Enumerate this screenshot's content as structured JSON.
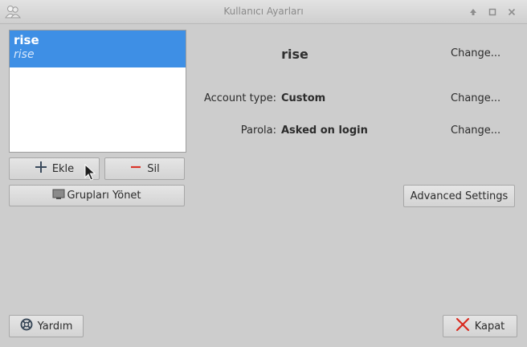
{
  "window": {
    "title": "Kullanıcı Ayarları"
  },
  "users": [
    {
      "name": "rise",
      "subtitle": "rise"
    }
  ],
  "toolbar": {
    "add_label": "Ekle",
    "delete_label": "Sil",
    "groups_label": "Grupları Yönet"
  },
  "details": {
    "name": "rise",
    "name_change": "Change...",
    "account_type_label": "Account type:",
    "account_type_value": "Custom",
    "account_type_change": "Change...",
    "password_label": "Parola:",
    "password_value": "Asked on login",
    "password_change": "Change...",
    "advanced_label": "Advanced Settings"
  },
  "footer": {
    "help_label": "Yardım",
    "close_label": "Kapat"
  },
  "icons": {
    "app": "users-icon",
    "add": "plus-icon",
    "delete": "minus-icon",
    "groups": "monitor-icon",
    "help": "lifebuoy-icon",
    "close": "close-x-icon"
  },
  "colors": {
    "selection": "#3e8fe5",
    "delete_accent": "#d9352a",
    "close_accent": "#d92b20",
    "plus_color": "#3a4a5c"
  }
}
